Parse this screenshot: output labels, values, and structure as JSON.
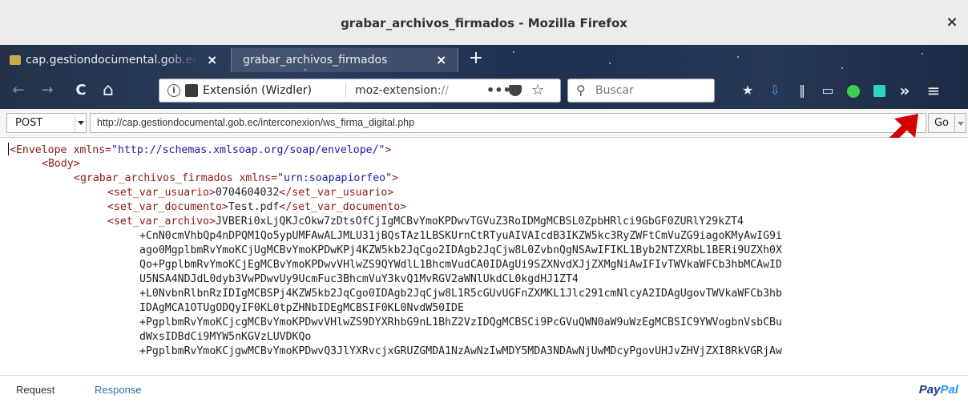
{
  "window": {
    "title": "grabar_archivos_firmados - Mozilla Firefox",
    "close_glyph": "×"
  },
  "tabs": [
    {
      "label": "cap.gestiondocumental.gob.ec",
      "close_glyph": "×",
      "active": false
    },
    {
      "label": "grabar_archivos_firmados",
      "close_glyph": "×",
      "active": true
    }
  ],
  "new_tab_glyph": "+",
  "navbar": {
    "back_glyph": "←",
    "forward_glyph": "→",
    "reload_glyph": "C",
    "home_glyph": "⌂",
    "extension_label": "Extensión (Wizdler)",
    "url_text": "moz-extension://",
    "more_glyph": "•••",
    "star_glyph": "☆",
    "search_placeholder": "Buscar",
    "search_glyph": "⚲",
    "right_icons": [
      "bookmark-star-icon",
      "download-icon",
      "library-icon",
      "sidebar-icon",
      "extension-green-icon",
      "save-icon",
      "overflow-icon",
      "menu-icon"
    ],
    "overflow_glyph": "»",
    "menu_glyph": "≡"
  },
  "request": {
    "method": "POST",
    "url": "http://cap.gestiondocumental.gob.ec/interconexion/ws_firma_digital.php",
    "go_label": "Go"
  },
  "annotation_color": "#d40000",
  "xml": {
    "envelope_open": "Envelope",
    "envelope_attr": "xmlns=",
    "envelope_ns": "\"http://schemas.xmlsoap.org/soap/envelope/\"",
    "body_open": "<Body>",
    "method_tag": "grabar_archivos_firmados",
    "method_attr": "xmlns=",
    "method_ns": "\"urn:soapapiorfeo\"",
    "usuario_open": "<set_var_usuario>",
    "usuario_value": "0704604032",
    "usuario_close": "</set_var_usuario>",
    "documento_open": "<set_var_documento>",
    "documento_value": "Test.pdf",
    "documento_close": "</set_var_documento>",
    "archivo_open": "<set_var_archivo>",
    "archivo_lines": [
      "JVBERi0xLjQKJcOkw7zDtsOfCjIgMCBvYmoKPDwvTGVuZ3RoIDMgMCBSL0ZpbHRlci9GbGF0ZURlY29kZT4",
      "+CnN0cmVhbQp4nDPQM1Qo5ypUMFAwALJMLU31jBQsTAz1LBSKUrnCtRTyuAIVAIcdB3IKZW5kc3RyZWFtCmVuZG9iagoKMyAwIG9i",
      "ago0MgplbmRvYmoKCjUgMCBvYmoKPDwKPj4KZW5kb2JqCgo2IDAgb2JqCjw8L0ZvbnQgNSAwIFIKL1Byb2NTZXRbL1BERi9UZXh0X",
      "Qo+PgplbmRvYmoKCjEgMCBvYmoKPDwvVHlwZS9QYWdlL1BhcmVudCA0IDAgUi9SZXNvdXJjZXMgNiAwIFIvTWVkaWFCb3hbMCAwID",
      "U5NSA4NDJdL0dyb3VwPDwvUy9UcmFuc3BhcmVuY3kvQ1MvRGV2aWNlUkdCL0kgdHJ1ZT4",
      "+L0NvbnRlbnRzIDIgMCBSPj4KZW5kb2JqCgo0IDAgb2JqCjw8L1R5cGUvUGFnZXMKL1Jlc291cmNlcyA2IDAgUgovTWVkaWFCb3hb",
      "IDAgMCA1OTUgODQyIF0KL0tpZHNbIDEgMCBSIF0KL0NvdW50IDE",
      "+PgplbmRvYmoKCjcgMCBvYmoKPDwvVHlwZS9DYXRhbG9nL1BhZ2VzIDQgMCBSCi9PcGVuQWN0aW9uWzEgMCBSIC9YWVogbnVsbCBu",
      "dWxsIDBdCi9MYW5nKGVzLUVDKQo",
      "+PgplbmRvYmoKCjgwMCBvYmoKPDwvQ3JlYXRvcjxGRUZGMDA1NzAwNzIwMDY5MDA3NDAwNjUwMDcyPgovUHJvZHVjZXI8RkVGRjAw"
    ]
  },
  "bottom": {
    "request_tab": "Request",
    "response_tab": "Response",
    "paypal_pay": "Pay",
    "paypal_pal": "Pal"
  }
}
